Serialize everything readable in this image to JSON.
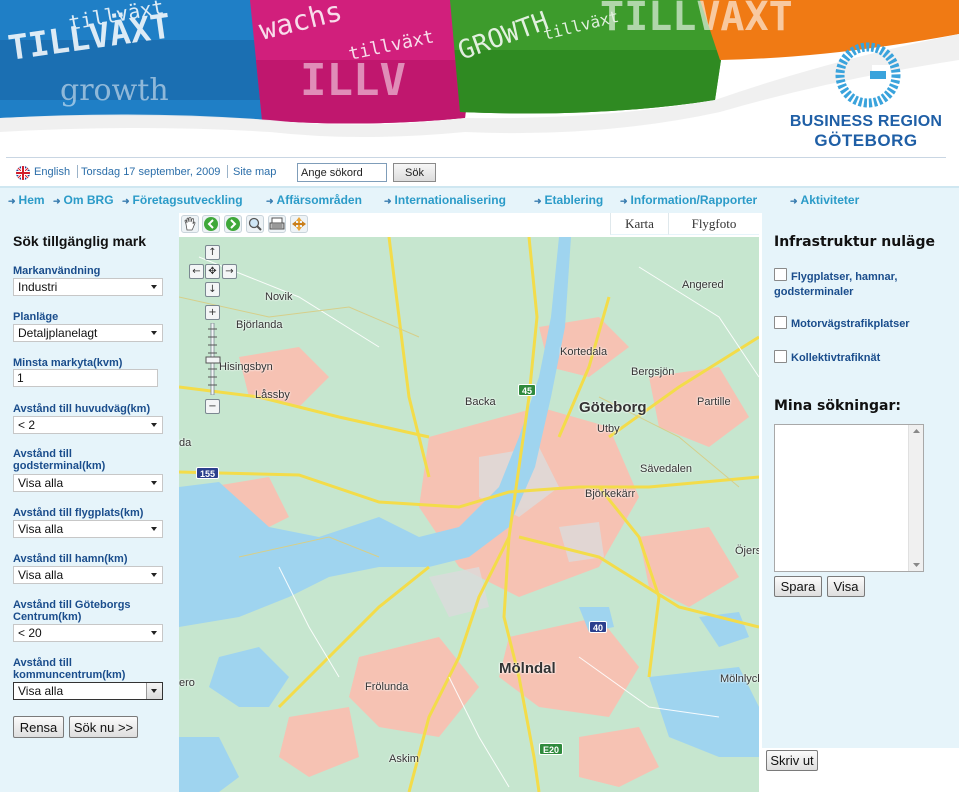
{
  "brand": {
    "line1": "BUSINESS REGION",
    "line2": "GÖTEBORG"
  },
  "banner_words": [
    "tillväxt",
    "växt",
    "growth",
    "wachstum",
    "TILLVÄXT",
    "GROWTH",
    "tillväxt",
    "TILLVÄXT"
  ],
  "utility": {
    "language": "English",
    "date": "Torsdag 17 september, 2009",
    "sitemap": "Site map",
    "search_placeholder": "Ange sökord",
    "search_button": "Sök"
  },
  "nav": [
    "Hem",
    "Om BRG",
    "Företagsutveckling",
    "Affärsområden",
    "Internationalisering",
    "Etablering",
    "Information/Rapporter",
    "Aktiviteter"
  ],
  "search_panel": {
    "title": "Sök tillgänglig mark",
    "fields": [
      {
        "label": "Markanvändning",
        "value": "Industri"
      },
      {
        "label": "Planläge",
        "value": "Detaljplanelagt"
      },
      {
        "label": "Minsta markyta(kvm)",
        "value": "1"
      },
      {
        "label": "Avstånd till huvudväg(km)",
        "value": "< 2"
      },
      {
        "label": "Avstånd till godsterminal(km)",
        "value": "Visa alla"
      },
      {
        "label": "Avstånd till flygplats(km)",
        "value": "Visa alla"
      },
      {
        "label": "Avstånd till hamn(km)",
        "value": "Visa alla"
      },
      {
        "label": "Avstånd till Göteborgs Centrum(km)",
        "value": "< 20"
      },
      {
        "label": "Avstånd till kommuncentrum(km)",
        "value": "Visa alla"
      }
    ],
    "reset_button": "Rensa",
    "search_button": "Sök nu >>"
  },
  "map": {
    "tabs": [
      "Karta",
      "Flygfoto"
    ],
    "places": [
      "Novik",
      "Björlanda",
      "Hisingsbyn",
      "Låssby",
      "Angered",
      "Kortedala",
      "Bergsjön",
      "Backa",
      "Göteborg",
      "Partille",
      "Utby",
      "Sävedalen",
      "Björkekärr",
      "Öjersjö",
      "Mölndal",
      "Frölunda",
      "Askim",
      "Mölnlycke",
      "da",
      "ero"
    ],
    "road_shields": [
      "45",
      "155",
      "40",
      "E20"
    ]
  },
  "infra_panel": {
    "title": "Infrastruktur nuläge",
    "options": [
      "Flygplatser, hamnar, godsterminaler",
      "Motorvägstrafikplatser",
      "Kollektivtrafiknät"
    ],
    "saved_title": "Mina sökningar:",
    "save_button": "Spara",
    "show_button": "Visa"
  },
  "print_button": "Skriv ut",
  "colors": {
    "accent": "#2b9bc8",
    "label": "#1a4d8c",
    "panel": "#e6f4fa",
    "brand": "#1f5fa6"
  }
}
